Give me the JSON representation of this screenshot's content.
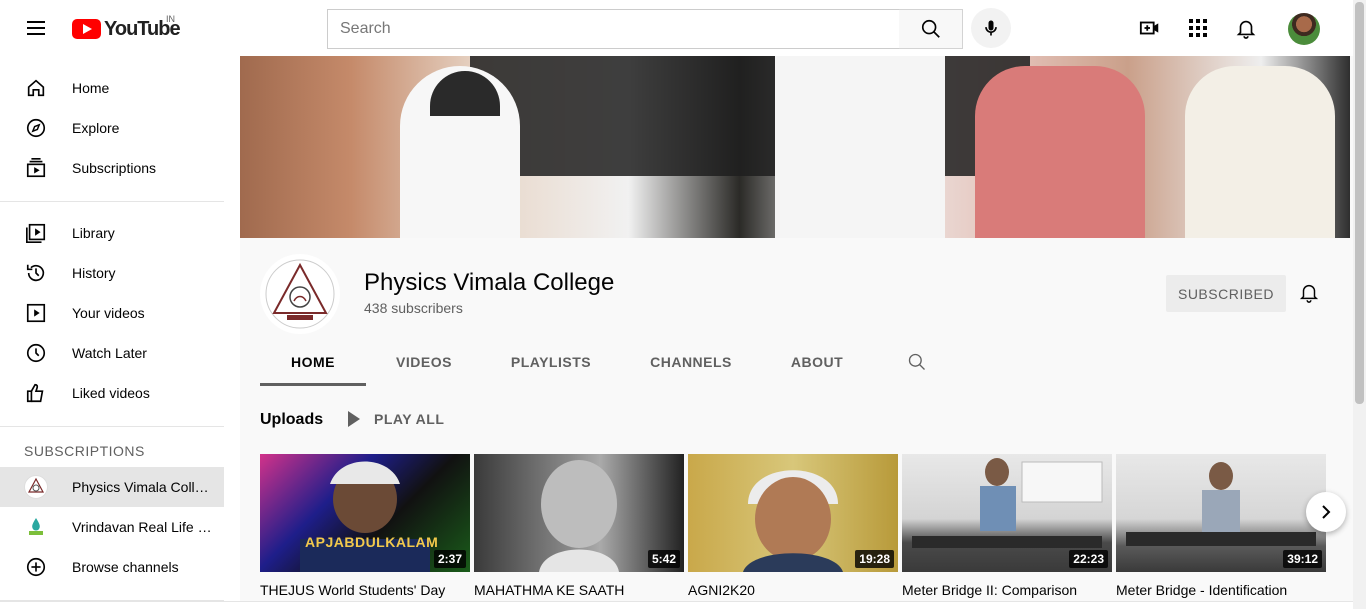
{
  "header": {
    "logo_text": "YouTube",
    "country_code": "IN",
    "search_placeholder": "Search"
  },
  "sidebar": {
    "primary": [
      {
        "label": "Home",
        "icon": "home-icon"
      },
      {
        "label": "Explore",
        "icon": "compass-icon"
      },
      {
        "label": "Subscriptions",
        "icon": "subscriptions-icon"
      }
    ],
    "library": [
      {
        "label": "Library",
        "icon": "library-icon"
      },
      {
        "label": "History",
        "icon": "history-icon"
      },
      {
        "label": "Your videos",
        "icon": "your-videos-icon"
      },
      {
        "label": "Watch Later",
        "icon": "clock-icon"
      },
      {
        "label": "Liked videos",
        "icon": "thumbs-up-icon"
      }
    ],
    "subscriptions_title": "SUBSCRIPTIONS",
    "subscriptions": [
      {
        "label": "Physics Vimala College",
        "active": true
      },
      {
        "label": "Vrindavan Real Life Lessons",
        "active": false
      }
    ],
    "browse_channels": "Browse channels"
  },
  "channel": {
    "name": "Physics Vimala College",
    "subscribers": "438 subscribers",
    "subscribe_label": "SUBSCRIBED",
    "tabs": [
      "HOME",
      "VIDEOS",
      "PLAYLISTS",
      "CHANNELS",
      "ABOUT"
    ],
    "active_tab": "HOME"
  },
  "uploads": {
    "title": "Uploads",
    "play_all": "PLAY ALL",
    "videos": [
      {
        "title": "THEJUS World Students' Day",
        "duration": "2:37",
        "overlay": "APJABDULKALAM"
      },
      {
        "title": "MAHATHMA KE SAATH",
        "duration": "5:42"
      },
      {
        "title": "AGNI2K20",
        "duration": "19:28"
      },
      {
        "title": "Meter Bridge II: Comparison",
        "duration": "22:23"
      },
      {
        "title": "Meter Bridge - Identification",
        "duration": "39:12"
      }
    ]
  },
  "colors": {
    "brand_red": "#ff0000",
    "text_primary": "#030303",
    "text_secondary": "#606060"
  }
}
